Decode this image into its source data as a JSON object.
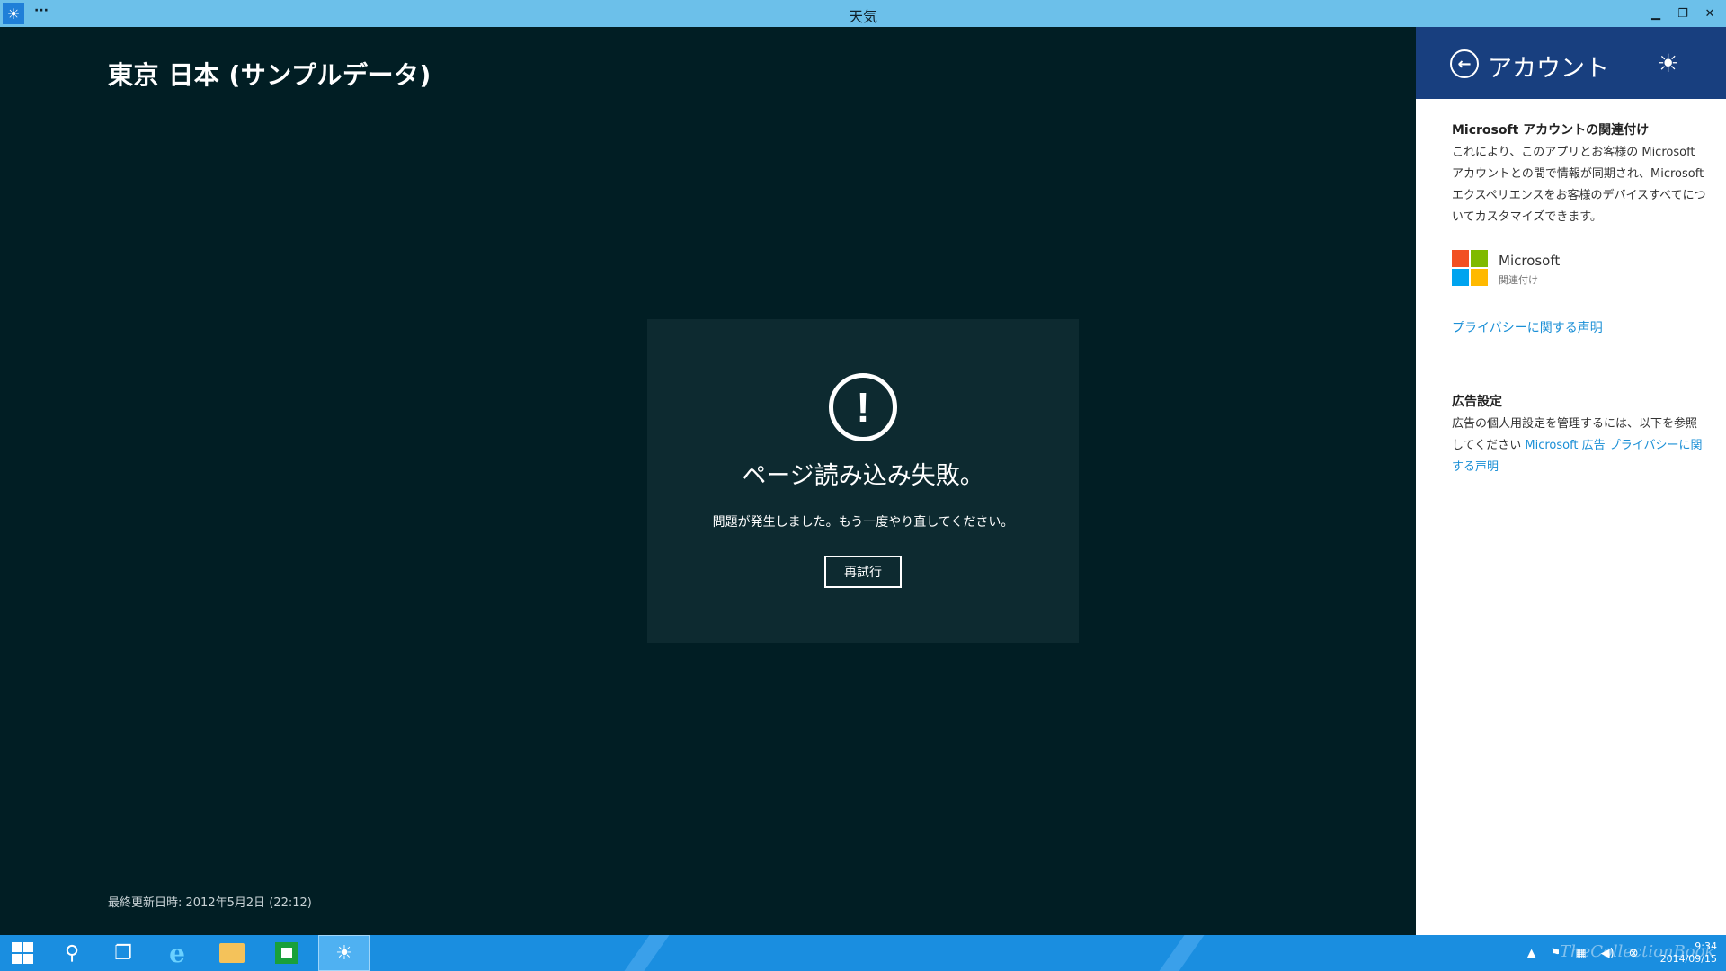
{
  "window": {
    "title": "天気",
    "menu_dots": "···",
    "minimize": "▁",
    "restore": "❐",
    "close": "✕"
  },
  "main": {
    "location_title": "東京 日本 (サンプルデータ)",
    "error": {
      "icon": "!",
      "title": "ページ読み込み失敗。",
      "message": "問題が発生しました。もう一度やり直してください。",
      "retry_label": "再試行"
    },
    "last_updated": "最終更新日時: 2012年5月2日 (22:12)"
  },
  "account_panel": {
    "title": "アカウント",
    "back_glyph": "←",
    "sun_glyph": "☀",
    "microsoft_account": {
      "heading": "Microsoft アカウントの関連付け",
      "body": "これにより、このアプリとお客様の Microsoft アカウントとの間で情報が同期され、Microsoft エクスペリエンスをお客様のデバイスすべてについてカスタマイズできます。",
      "provider_name": "Microsoft",
      "provider_action": "関連付け"
    },
    "privacy_link": "プライバシーに関する声明",
    "ads": {
      "heading": "広告設定",
      "body_prefix": "広告の個人用設定を管理するには、以下を参照してください ",
      "link": "Microsoft 広告 プライバシーに関する声明"
    }
  },
  "colors": {
    "ms_red": "#f25022",
    "ms_green": "#7fba00",
    "ms_blue": "#00a4ef",
    "ms_yellow": "#ffb900"
  },
  "taskbar": {
    "search_glyph": "⚲",
    "task_view_glyph": "❐",
    "ie_glyph": "e",
    "weather_glyph": "☀",
    "tray_up": "▲",
    "tray_flag": "⚑",
    "tray_network": "▦",
    "tray_volume": "◀)",
    "tray_other": "⊗",
    "time": "9:34",
    "date": "2014/09/15",
    "watermark": "TheCollectionBook"
  }
}
